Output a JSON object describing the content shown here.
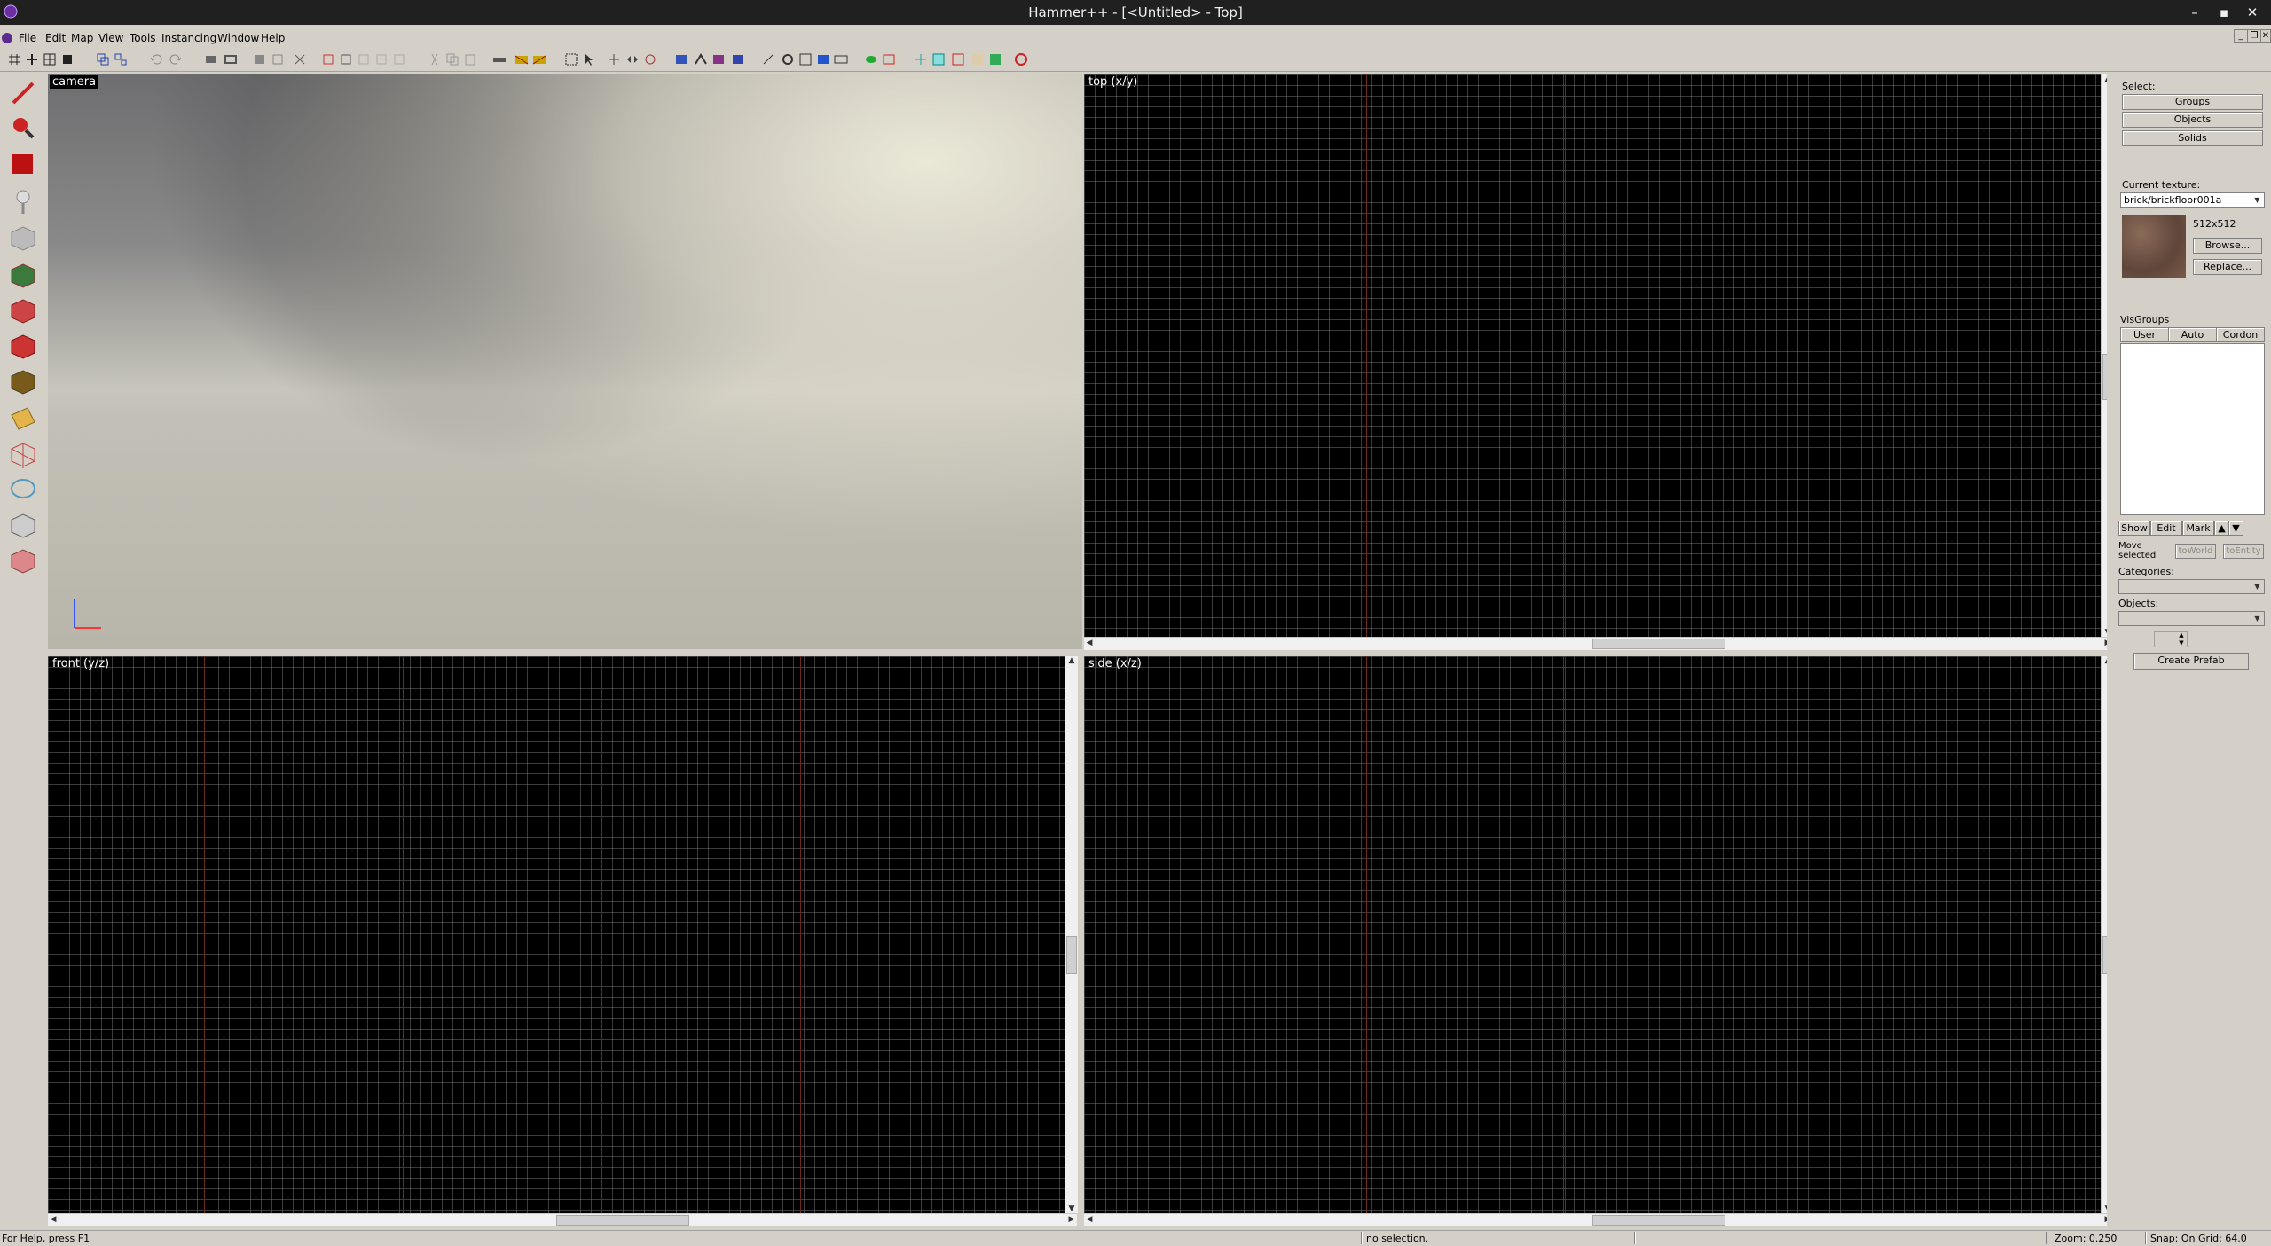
{
  "window": {
    "title": "Hammer++ - [<Untitled> - Top]"
  },
  "menu": {
    "items": [
      "File",
      "Edit",
      "Map",
      "View",
      "Tools",
      "Instancing",
      "Window",
      "Help"
    ]
  },
  "toolbar": {
    "icons": [
      "grid-icon",
      "grid-toggle-icon",
      "grid-larger-icon",
      "grid-smaller-icon",
      "group-icon",
      "ungroup-icon",
      "undo-icon",
      "redo-icon",
      "carve-icon",
      "hollow-icon",
      "hide-icon",
      "unhide-icon",
      "cut-icon",
      "copy-icon",
      "paste-icon",
      "texture-lock-icon",
      "vertex-icon",
      "run-map-icon"
    ]
  },
  "left_tools": {
    "icons": [
      "selection-tool-icon",
      "magnify-tool-icon",
      "camera-tool-icon",
      "entity-tool-icon",
      "block-tool-icon",
      "texture-tool-icon",
      "apply-texture-icon",
      "decal-tool-icon",
      "overlay-tool-icon",
      "clip-tool-icon",
      "vertex-tool-icon",
      "path-tool-icon",
      "sprinkle-tool-icon",
      "cordon-tool-icon"
    ]
  },
  "viewports": {
    "camera": {
      "label": "camera"
    },
    "top": {
      "label": "top (x/y)"
    },
    "front": {
      "label": "front (y/z)"
    },
    "side": {
      "label": "side (x/z)"
    }
  },
  "right_panel": {
    "select_label": "Select:",
    "select_buttons": [
      "Groups",
      "Objects",
      "Solids"
    ],
    "texture_label": "Current texture:",
    "texture_value": "brick/brickfloor001a",
    "texture_size": "512x512",
    "browse_button": "Browse...",
    "replace_button": "Replace...",
    "visgroups_label": "VisGroups",
    "visgroup_tabs": [
      "User",
      "Auto",
      "Cordon"
    ],
    "visgroup_buttons": [
      "Show",
      "Edit",
      "Mark"
    ],
    "move_selected": "Move selected",
    "to_world": "toWorld",
    "to_entity": "toEntity",
    "categories_label": "Categories:",
    "objects_label": "Objects:",
    "create_prefab": "Create Prefab"
  },
  "status": {
    "help": "For Help, press F1",
    "selection": "no selection.",
    "zoom": "Zoom: 0.250",
    "snap": "Snap: On Grid: 64.0"
  },
  "colors": {
    "title_bg": "#202020",
    "chrome": "#d4d0c8",
    "viewport_bg": "#000000",
    "grid_line": "#6e6e6e",
    "axis_red": "#7a2a1a",
    "axis_teal": "#1a5a5a"
  }
}
